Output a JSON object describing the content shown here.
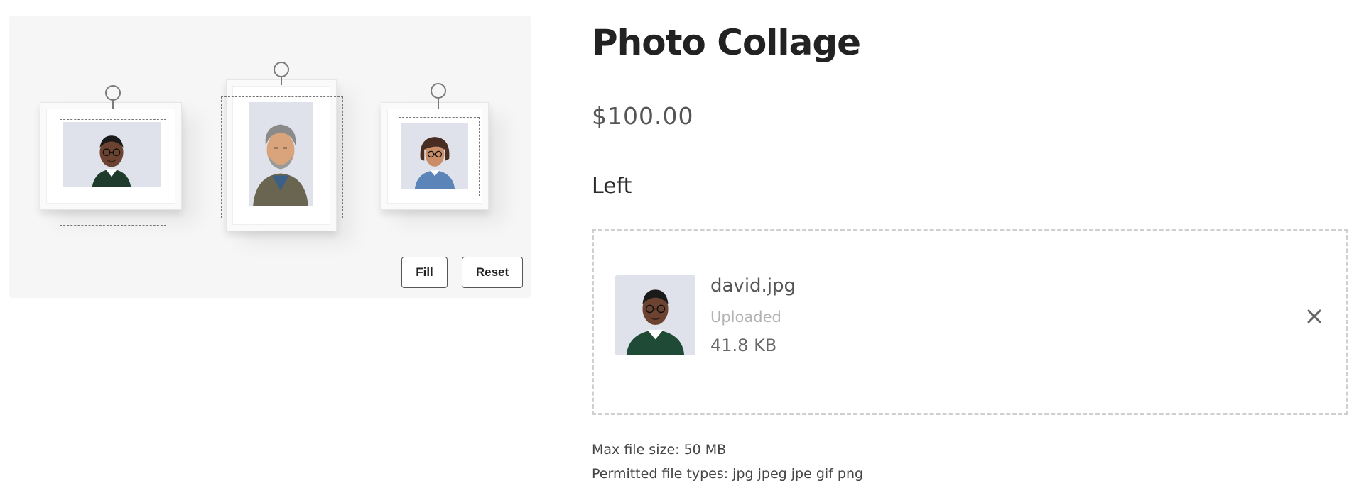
{
  "preview": {
    "buttons": {
      "fill_label": "Fill",
      "reset_label": "Reset"
    }
  },
  "product": {
    "title": "Photo Collage",
    "price": "$100.00"
  },
  "upload": {
    "field_label": "Left",
    "file": {
      "name": "david.jpg",
      "status": "Uploaded",
      "size": "41.8 KB"
    },
    "remove_icon": "close-icon"
  },
  "help": {
    "max_size": "Max file size: 50 MB",
    "file_types": "Permitted file types: jpg jpeg jpe gif png"
  },
  "colors": {
    "panel_bg": "#f6f6f6",
    "photo_bg": "#dfe2ea",
    "dropzone_border": "#cfcfcf",
    "status_text": "#b3b3b3"
  }
}
